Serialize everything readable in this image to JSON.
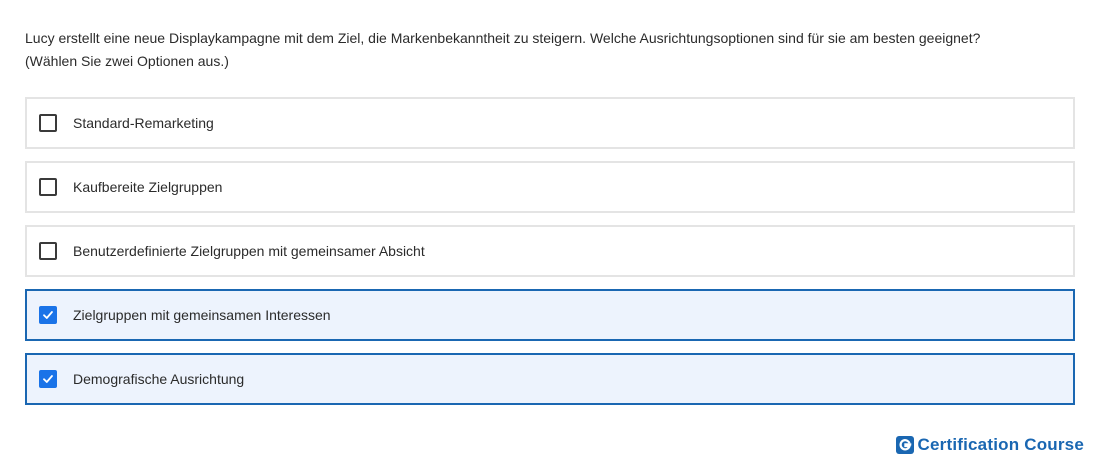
{
  "question": {
    "line1": "Lucy erstellt eine neue Displaykampagne mit dem Ziel, die Markenbekanntheit zu steigern. Welche Ausrichtungsoptionen sind für sie am besten geeignet?",
    "line2": "(Wählen Sie zwei Optionen aus.)"
  },
  "options": [
    {
      "label": "Standard-Remarketing",
      "checked": false
    },
    {
      "label": "Kaufbereite Zielgruppen",
      "checked": false
    },
    {
      "label": "Benutzerdefinierte Zielgruppen mit gemeinsamer Absicht",
      "checked": false
    },
    {
      "label": "Zielgruppen mit gemeinsamen Interessen",
      "checked": true
    },
    {
      "label": "Demografische Ausrichtung",
      "checked": true
    }
  ],
  "brand": {
    "logo_letter": "G",
    "name": "Certification Course"
  },
  "colors": {
    "accent": "#1a73e8",
    "selected_border": "#1a67b2",
    "selected_bg": "#edf3fd",
    "brand": "#1a67b2"
  }
}
